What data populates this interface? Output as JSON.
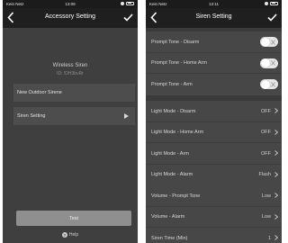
{
  "left": {
    "status": {
      "carrier": "Kein Netz",
      "time": "13:09"
    },
    "title": "Accessory Setting",
    "device_name": "Wireless Siren",
    "device_id": "ID: !DH3bvRr",
    "rows": [
      {
        "label": "New Outdoor Sirene"
      },
      {
        "label": "Siren Setting"
      }
    ],
    "test_label": "Test",
    "help_label": "Help"
  },
  "right": {
    "status": {
      "carrier": "Kein Netz",
      "time": "13:11"
    },
    "title": "Siren Setting",
    "groups": [
      [
        {
          "label": "Prompt Tone - Disarm",
          "toggle": "off"
        },
        {
          "label": "Prompt Tone - Home Arm",
          "toggle": "off"
        },
        {
          "label": "Prompt Tone - Arm",
          "toggle": "off"
        }
      ],
      [
        {
          "label": "Light Mode - Disarm",
          "value": "OFF"
        },
        {
          "label": "Light Mode - Home Arm",
          "value": "OFF"
        },
        {
          "label": "Light Mode - Arm",
          "value": "OFF"
        },
        {
          "label": "Light Mode - Alarm",
          "value": "Flash"
        }
      ],
      [
        {
          "label": "Volume - Prompt Tone",
          "value": "Low"
        },
        {
          "label": "Volume - Alarm",
          "value": "Low"
        },
        {
          "label": "Siren Time (Min)",
          "value": "1"
        }
      ]
    ]
  },
  "icons": {
    "back": "chevron-left-icon",
    "confirm": "checkmark-icon",
    "row_arrow": "play-triangle-icon",
    "row_chevron": "chevron-right-icon",
    "help": "question-circle-icon",
    "wifi": "wifi-icon",
    "battery": "battery-icon"
  },
  "colors": {
    "screen_bg": "#3f3f3f",
    "nav_bg": "#1f1f1f",
    "row_bg": "#474747",
    "test_button": "#8f8f8f"
  }
}
